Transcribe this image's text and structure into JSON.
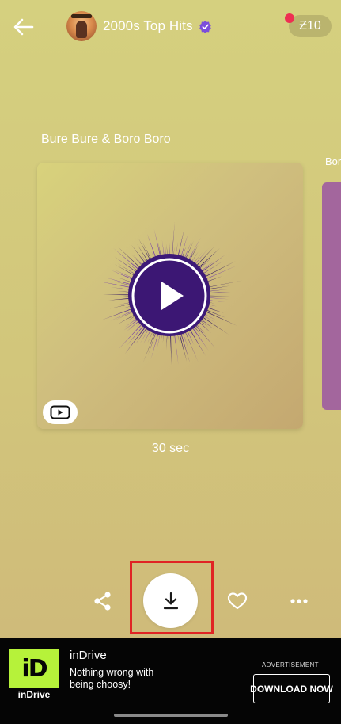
{
  "header": {
    "back_icon": "arrow-left-icon",
    "channel_name": "2000s Top Hits",
    "avatar_text": "2000s Top Hits",
    "verified_icon": "verified-badge-icon",
    "coin_balance": "Ƶ10",
    "notification_color": "#ee2f52"
  },
  "track": {
    "title": "Bure Bure & Boro Boro",
    "next_title_partial": "Boro",
    "duration": "30 sec",
    "play_icon": "play-icon",
    "source_icon": "youtube-icon"
  },
  "actions": {
    "share_icon": "share-icon",
    "download_icon": "download-icon",
    "like_icon": "heart-icon",
    "more_icon": "more-dots-icon"
  },
  "ad": {
    "logo_glyph": "iD",
    "logo_text": "inDrive",
    "title": "inDrive",
    "description": "Nothing wrong with being choosy!",
    "label": "ADVERTISEMENT",
    "cta": "DOWNLOAD NOW",
    "logo_color": "#b6f23a"
  },
  "colors": {
    "highlight": "#e02424",
    "next_card": "#a3669d",
    "burst": "#4b1f8a"
  }
}
